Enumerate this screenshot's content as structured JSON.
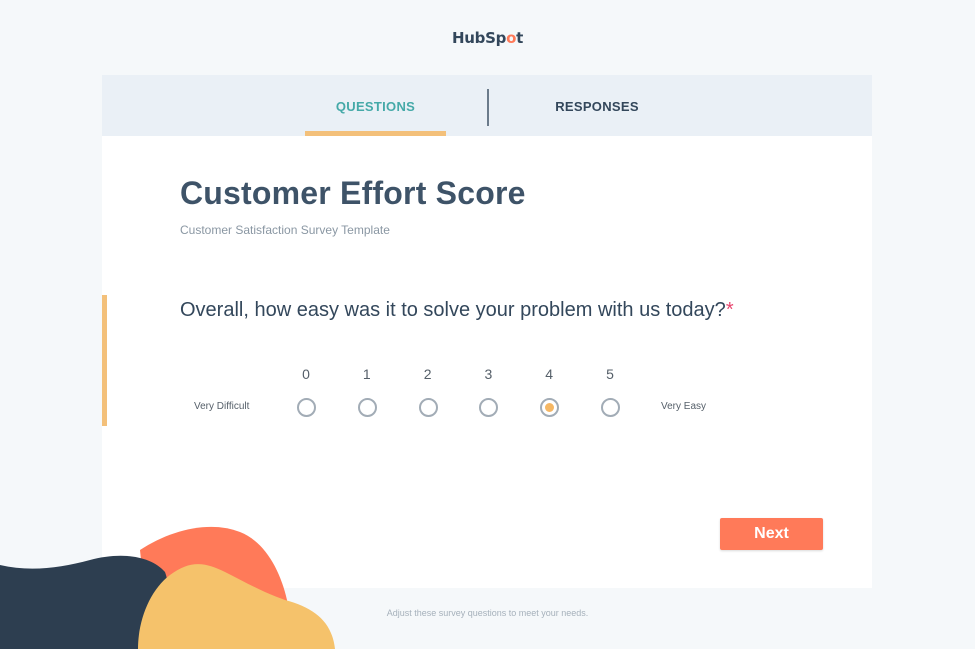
{
  "brand": {
    "logo_prefix": "HubS",
    "logo_spro": "p",
    "logo_o": "o",
    "logo_suffix": "t"
  },
  "tabs": [
    {
      "label": "QUESTIONS",
      "active": true
    },
    {
      "label": "RESPONSES",
      "active": false
    }
  ],
  "survey": {
    "title": "Customer Effort Score",
    "subtitle": "Customer Satisfaction Survey Template",
    "question": "Overall, how easy was it to solve your problem with us today?",
    "required_marker": "*",
    "scale": {
      "options": [
        "0",
        "1",
        "2",
        "3",
        "4",
        "5"
      ],
      "selected": "4",
      "low_label": "Very Difficult",
      "high_label": "Very Easy"
    }
  },
  "actions": {
    "next_label": "Next"
  },
  "footer": {
    "note": "Adjust these survey questions to meet your needs."
  },
  "colors": {
    "accent_orange": "#ff7a59",
    "accent_yellow": "#f5c26b",
    "navy": "#2d3e50",
    "teal": "#45a9a8"
  }
}
